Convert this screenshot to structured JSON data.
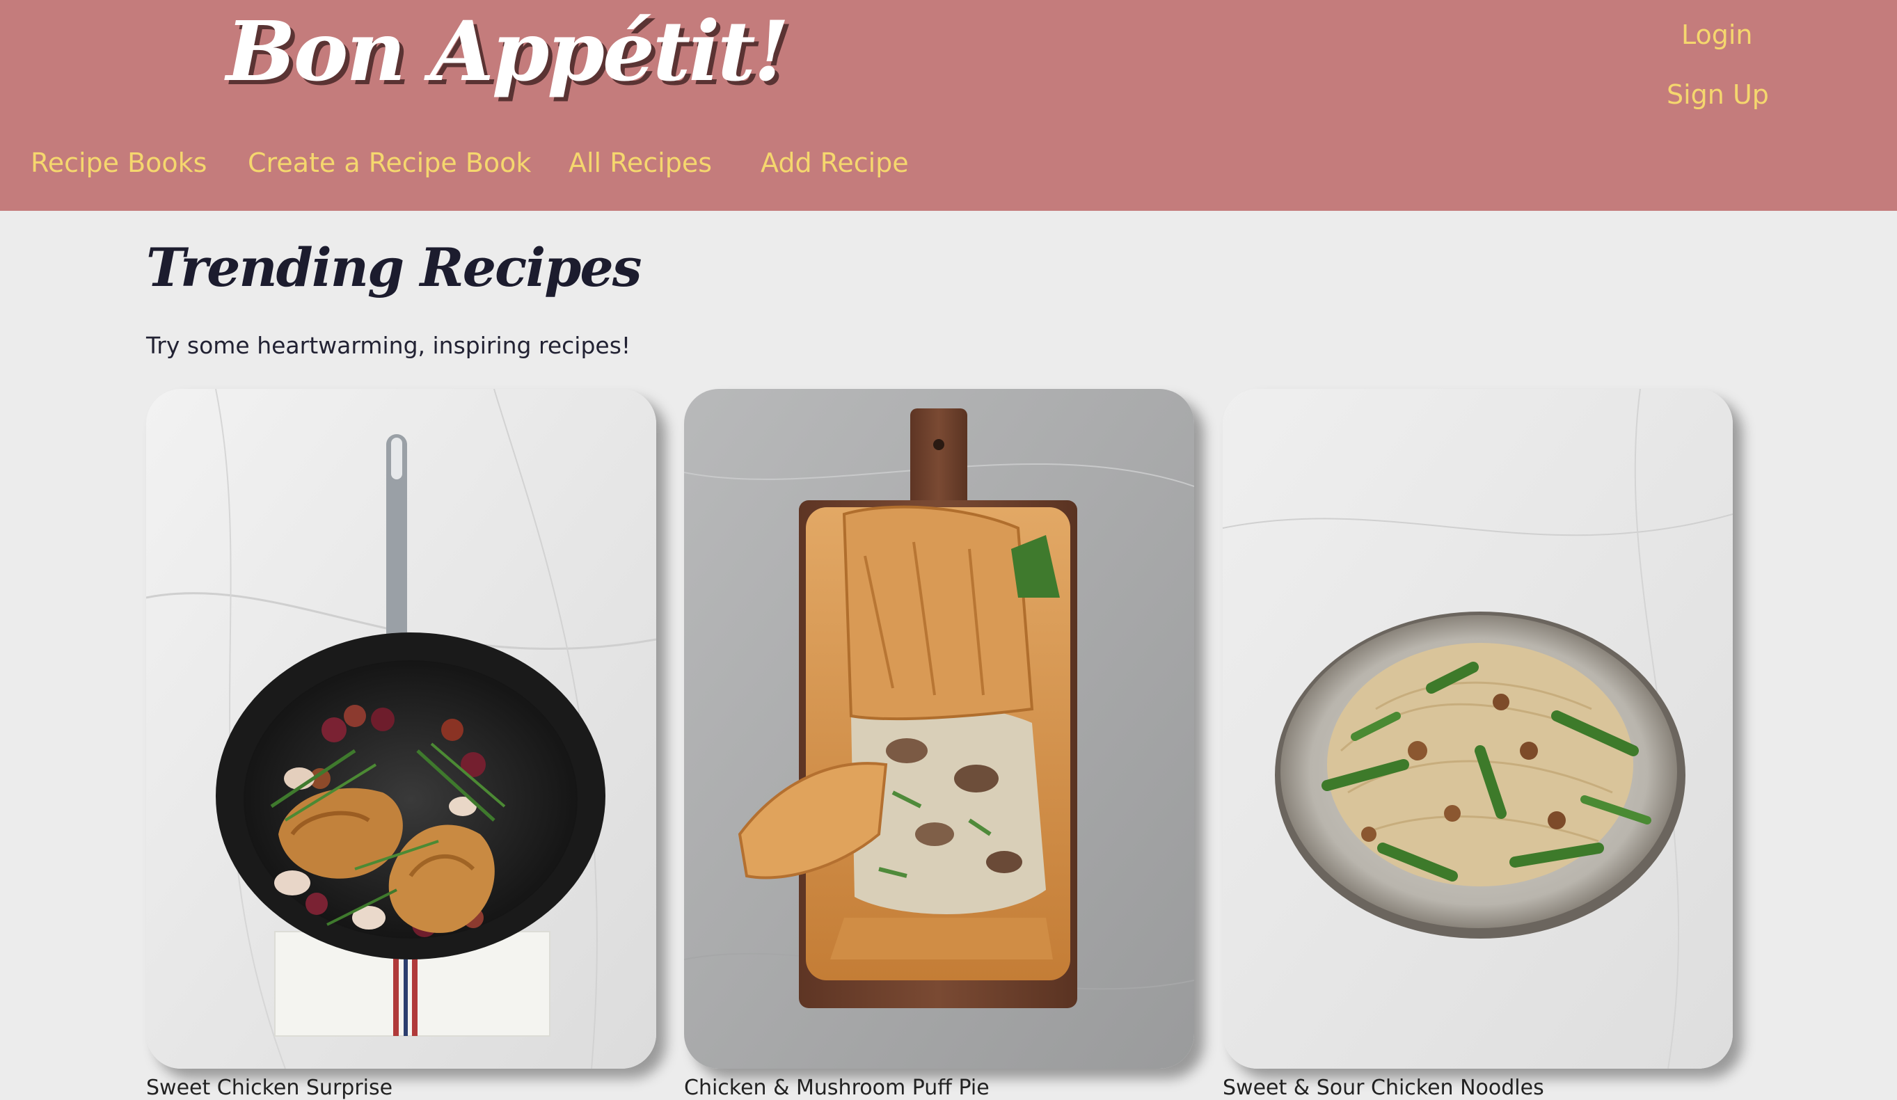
{
  "header": {
    "brand": "Bon Appétit!",
    "login": "Login",
    "signup": "Sign Up",
    "nav": [
      "Recipe Books",
      "Create a Recipe Book",
      "All Recipes",
      "Add Recipe"
    ]
  },
  "main": {
    "title": "Trending Recipes",
    "subtitle": "Try some heartwarming, inspiring recipes!",
    "recipes": [
      {
        "name": "Sweet Chicken Surprise"
      },
      {
        "name": "Chicken & Mushroom Puff Pie"
      },
      {
        "name": "Sweet & Sour Chicken Noodles"
      }
    ]
  },
  "colors": {
    "header_bg": "#c47c7c",
    "nav_text": "#f5d76e",
    "page_bg": "#ececec"
  }
}
